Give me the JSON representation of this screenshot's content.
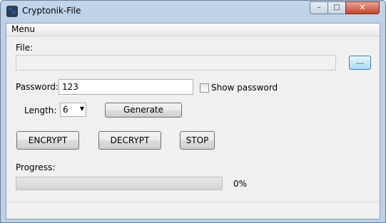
{
  "window": {
    "title": "Cryptonik-File",
    "controls": {
      "minimize": "–",
      "maximize": "□",
      "close": "✕"
    }
  },
  "menu": {
    "items": [
      "Menu"
    ]
  },
  "file": {
    "label": "File:",
    "value": "",
    "browse_label": "..."
  },
  "password": {
    "label": "Password:",
    "value": "123",
    "show_label": "Show password",
    "show_checked": false
  },
  "length": {
    "label": "Length:",
    "value": "6"
  },
  "buttons": {
    "generate": "Generate",
    "encrypt": "ENCRYPT",
    "decrypt": "DECRYPT",
    "stop": "STOP"
  },
  "progress": {
    "label": "Progress:",
    "value": 0,
    "percent_text": "0%"
  },
  "icons": {
    "app": "paw-icon",
    "combo": "chevron-down-icon"
  }
}
